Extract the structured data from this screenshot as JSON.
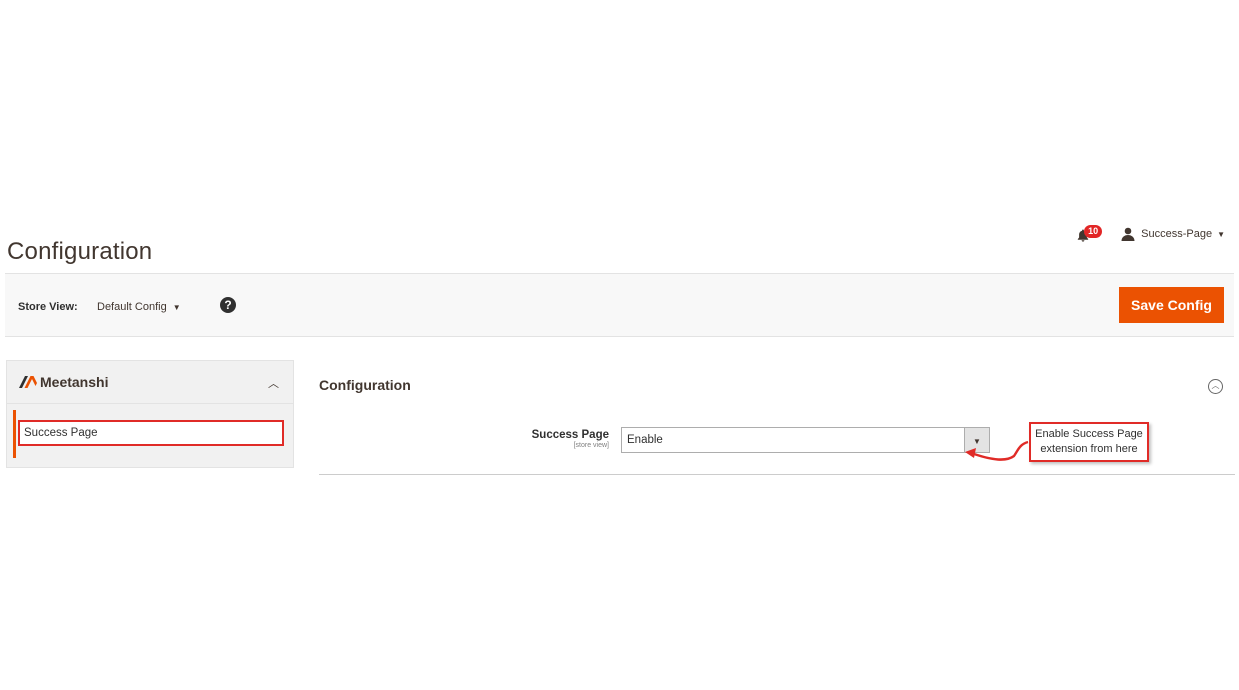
{
  "header": {
    "title": "Configuration",
    "notification_count": "10",
    "user_name": "Success-Page"
  },
  "toolbar": {
    "store_view_label": "Store View:",
    "store_view_value": "Default Config",
    "help_icon": "?",
    "save_label": "Save Config"
  },
  "sidebar": {
    "brand": "Meetanshi",
    "items": [
      {
        "label": "Success Page",
        "active": true
      }
    ]
  },
  "section": {
    "title": "Configuration",
    "fields": [
      {
        "label": "Success Page",
        "scope": "[store view]",
        "value": "Enable"
      }
    ]
  },
  "annotation": {
    "line1": "Enable Success Page",
    "line2": "extension from here"
  },
  "colors": {
    "accent": "#eb5202",
    "highlight_border": "#e02b27",
    "badge": "#e22626"
  }
}
